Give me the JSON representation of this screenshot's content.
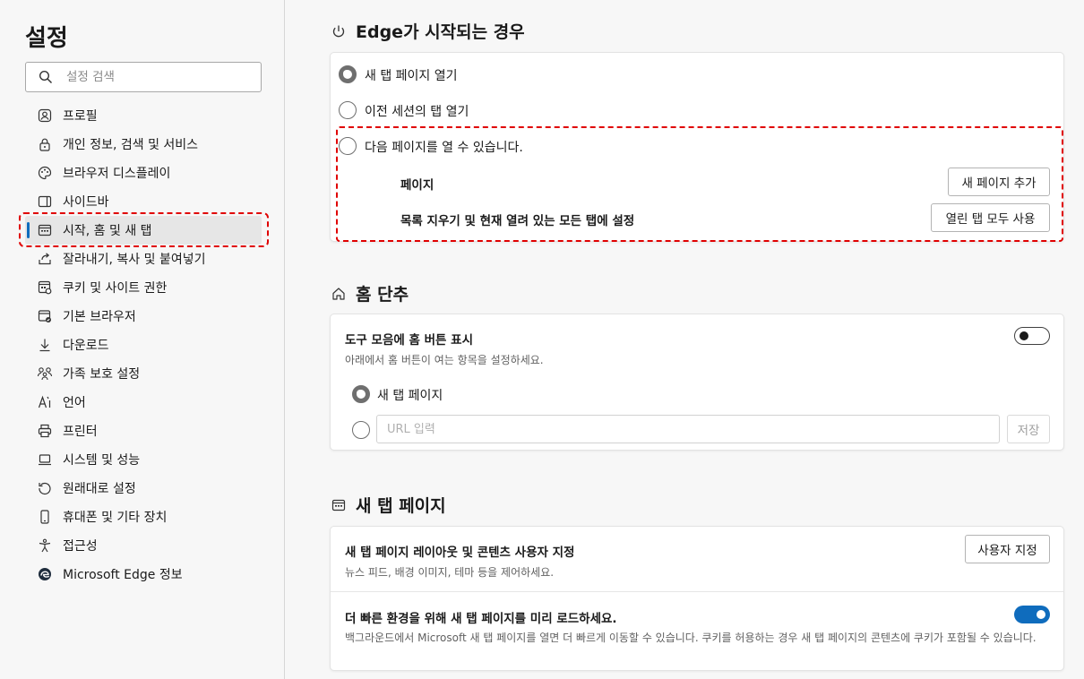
{
  "sidebar": {
    "title": "설정",
    "search_placeholder": "설정 검색",
    "items": [
      {
        "label": "프로필",
        "icon": "profile-icon"
      },
      {
        "label": "개인 정보, 검색 및 서비스",
        "icon": "lock-icon"
      },
      {
        "label": "브라우저 디스플레이",
        "icon": "palette-icon"
      },
      {
        "label": "사이드바",
        "icon": "sidebar-icon"
      },
      {
        "label": "시작, 홈 및 새 탭",
        "icon": "start-home-tab-icon",
        "active": true
      },
      {
        "label": "잘라내기, 복사 및 붙여넣기",
        "icon": "share-icon"
      },
      {
        "label": "쿠키 및 사이트 권한",
        "icon": "cookie-permissions-icon"
      },
      {
        "label": "기본 브라우저",
        "icon": "default-browser-icon"
      },
      {
        "label": "다운로드",
        "icon": "download-icon"
      },
      {
        "label": "가족 보호 설정",
        "icon": "family-icon"
      },
      {
        "label": "언어",
        "icon": "language-icon"
      },
      {
        "label": "프린터",
        "icon": "printer-icon"
      },
      {
        "label": "시스템 및 성능",
        "icon": "system-icon"
      },
      {
        "label": "원래대로 설정",
        "icon": "reset-icon"
      },
      {
        "label": "휴대폰 및 기타 장치",
        "icon": "phone-icon"
      },
      {
        "label": "접근성",
        "icon": "accessibility-icon"
      },
      {
        "label": "Microsoft Edge 정보",
        "icon": "edge-logo-icon"
      }
    ]
  },
  "startup": {
    "title": "Edge가 시작되는 경우",
    "icon": "power-icon",
    "options": [
      {
        "label": "새 탭 페이지 열기",
        "checked": true
      },
      {
        "label": "이전 세션의 탭 열기",
        "checked": false
      },
      {
        "label": "다음 페이지를 열 수 있습니다.",
        "checked": false
      }
    ],
    "pages_label": "페이지",
    "add_page_button": "새 페이지 추가",
    "clear_label": "목록 지우기 및 현재 열려 있는 모든 탭에 설정",
    "use_open_tabs_button": "열린 탭 모두 사용"
  },
  "home": {
    "title": "홈 단추",
    "icon": "home-icon",
    "show_label": "도구 모음에 홈 버튼 표시",
    "show_desc": "아래에서 홈 버튼이 여는 항목을 설정하세요.",
    "toggle_on": false,
    "option_new_tab": "새 탭 페이지",
    "url_placeholder": "URL 입력",
    "save_button": "저장"
  },
  "newtab": {
    "title": "새 탭 페이지",
    "icon": "new-tab-page-icon",
    "customize_label": "새 탭 페이지 레이아웃 및 콘텐츠 사용자 지정",
    "customize_desc": "뉴스 피드, 배경 이미지, 테마 등을 제어하세요.",
    "customize_button": "사용자 지정",
    "preload_label": "더 빠른 환경을 위해 새 탭 페이지를 미리 로드하세요.",
    "preload_desc": "백그라운드에서 Microsoft 새 탭 페이지를 열면 더 빠르게 이동할 수 있습니다. 쿠키를 허용하는 경우 새 탭 페이지의 콘텐츠에 쿠키가 포함될 수 있습니다.",
    "preload_on": true
  },
  "colors": {
    "accent": "#0f6cbd",
    "highlight": "#e00000"
  }
}
